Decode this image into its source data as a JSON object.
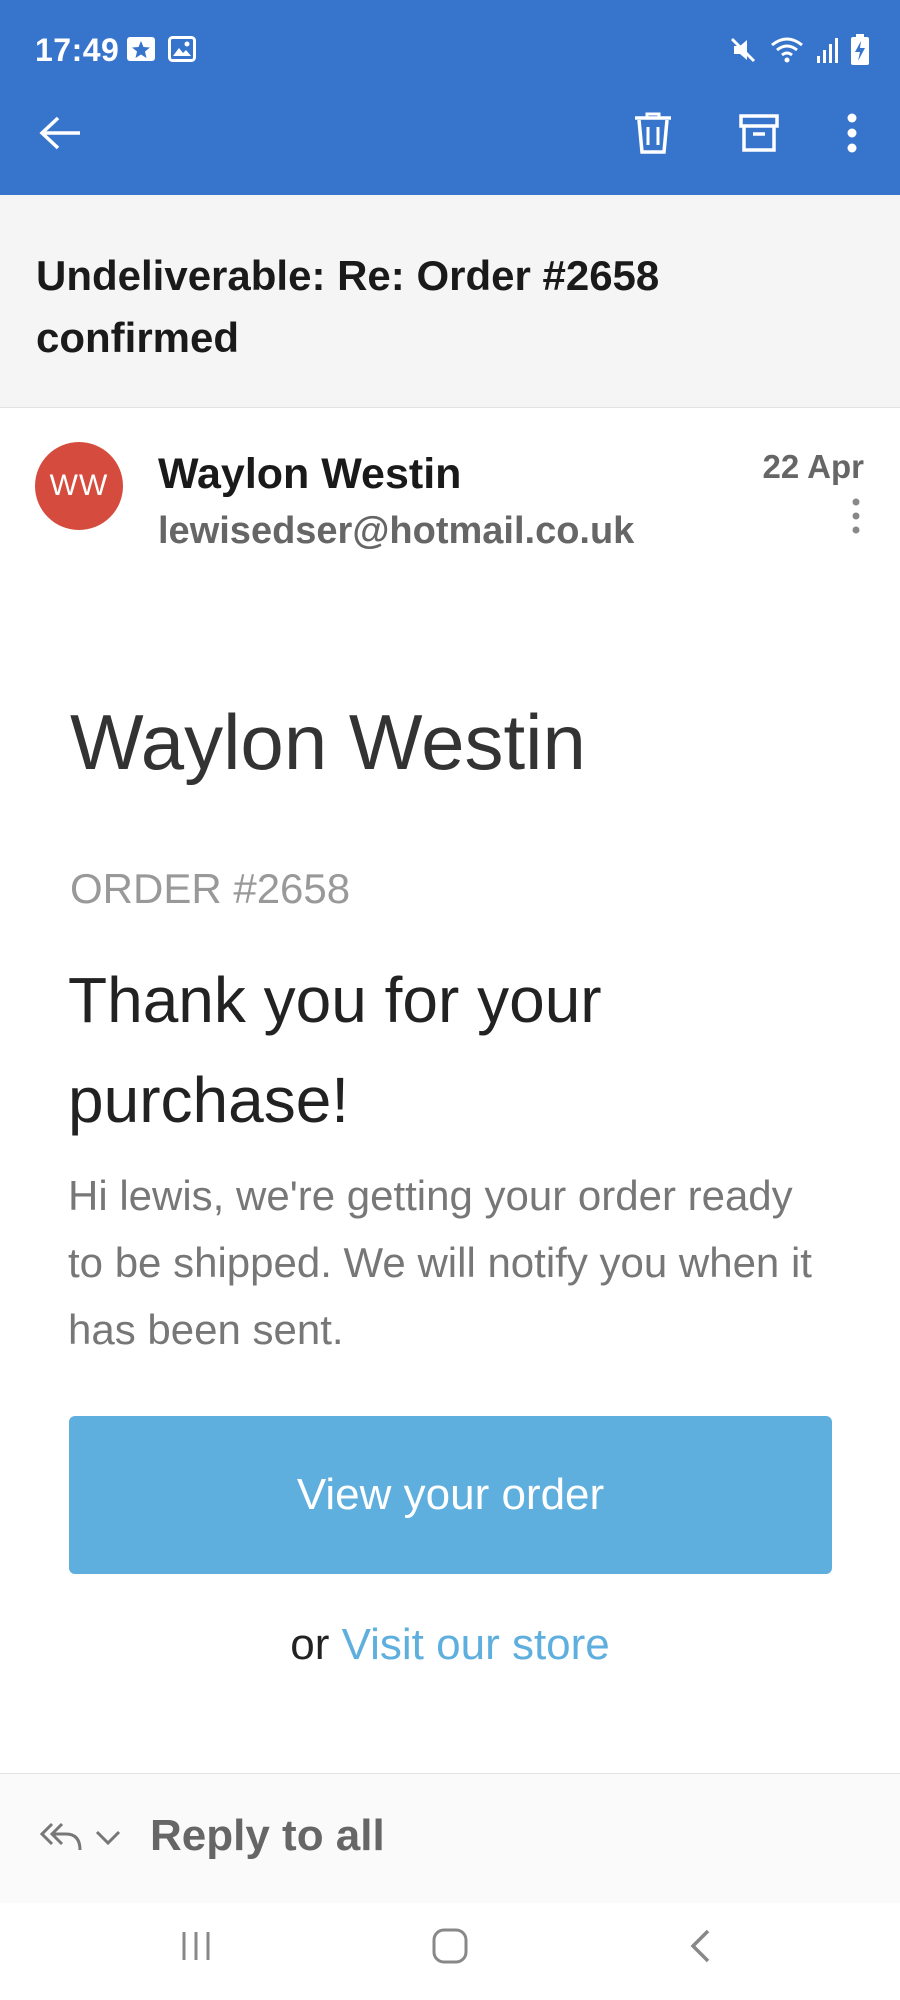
{
  "status_bar": {
    "time": "17:49",
    "left_icons": [
      "calendar-star-icon",
      "image-icon"
    ],
    "right_icons": [
      "mute-icon",
      "wifi-icon",
      "signal-icon",
      "battery-charging-icon"
    ]
  },
  "toolbar": {
    "icons": [
      "back-arrow-icon",
      "trash-icon",
      "archive-icon",
      "more-vert-icon"
    ]
  },
  "email": {
    "subject": "Undeliverable: Re: Order #2658 confirmed",
    "sender": {
      "initials": "WW",
      "name": "Waylon Westin",
      "email": "lewisedser@hotmail.co.uk",
      "avatar_color": "#d54c3f"
    },
    "date": "22 Apr",
    "body": {
      "store_name": "Waylon Westin",
      "order_label": "ORDER #2658",
      "heading": "Thank you for your purchase!",
      "message": "Hi lewis, we're getting your order ready to be shipped. We will notify you when it has been sent.",
      "button_label": "View your order",
      "alt_prefix": "or",
      "alt_link": "Visit our store"
    }
  },
  "reply_bar": {
    "label": "Reply to all",
    "icons": [
      "reply-all-icon",
      "chevron-down-icon"
    ]
  },
  "nav_bar": {
    "icons": [
      "recents-icon",
      "home-icon",
      "back-icon"
    ]
  },
  "colors": {
    "app_bar": "#3775cc",
    "subject_background": "#f5f5f5",
    "button": "#5eaede",
    "link": "#5eaede"
  }
}
